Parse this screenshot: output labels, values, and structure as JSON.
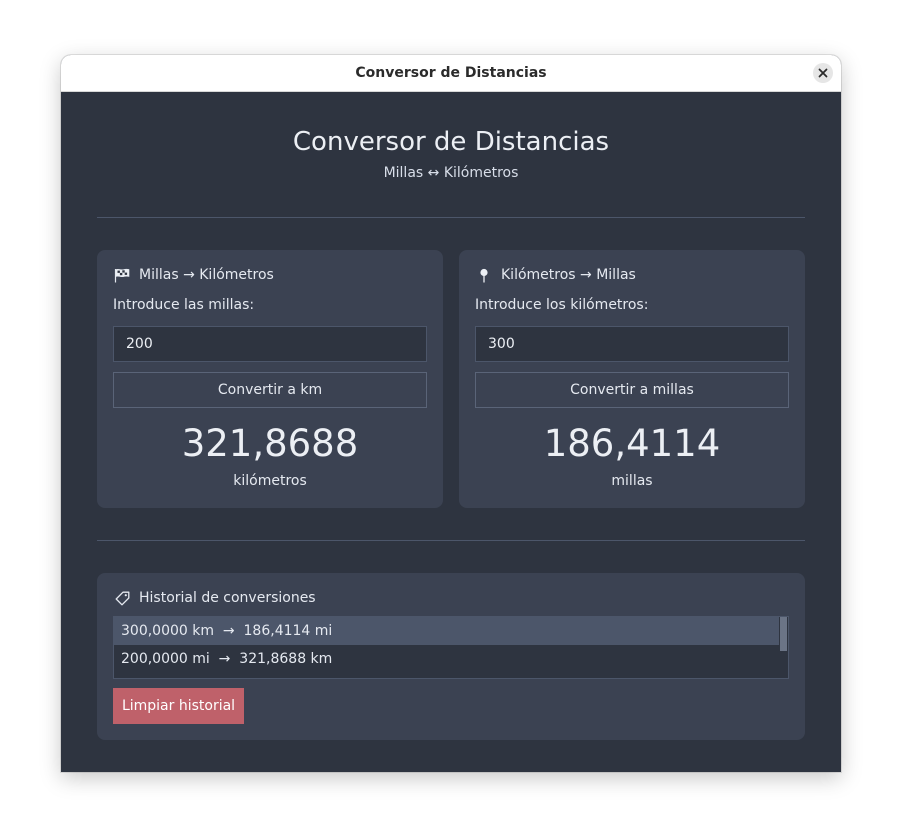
{
  "window": {
    "title": "Conversor de Distancias"
  },
  "header": {
    "title": "Conversor de Distancias",
    "subtitle": "Millas ↔ Kilómetros"
  },
  "miles_to_km": {
    "icon": "checkered-flag-icon",
    "title": "Millas → Kilómetros",
    "input_label": "Introduce las millas:",
    "input_value": "200",
    "button_label": "Convertir a km",
    "result_value": "321,8688",
    "result_unit": "kilómetros"
  },
  "km_to_miles": {
    "icon": "map-pin-icon",
    "title": "Kilómetros → Millas",
    "input_label": "Introduce los kilómetros:",
    "input_value": "300",
    "button_label": "Convertir a millas",
    "result_value": "186,4114",
    "result_unit": "millas"
  },
  "history": {
    "icon": "tag-icon",
    "title": "Historial de conversiones",
    "items": [
      "300,0000 km  →  186,4114 mi",
      "200,0000 mi  →  321,8688 km"
    ],
    "clear_label": "Limpiar historial"
  },
  "colors": {
    "background": "#2e3440",
    "card": "#3b4252",
    "accent_danger": "#bf616a",
    "selected_row": "#4c566a",
    "text": "#e5e9f0"
  }
}
